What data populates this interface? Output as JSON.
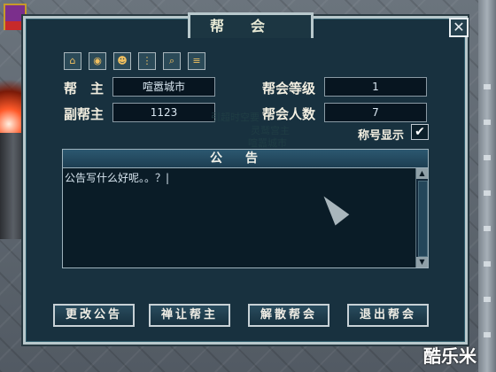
{
  "window": {
    "title": "帮会",
    "close_glyph": "✕"
  },
  "toolbar_icons": [
    "home-icon",
    "ring-icon",
    "members-icon",
    "tree-icon",
    "search-icon",
    "notes-icon"
  ],
  "fields": {
    "leader_label": "帮　主",
    "leader_value": "喧嚣城市",
    "vice_label": "副帮主",
    "vice_value": "1123",
    "level_label": "帮会等级",
    "level_value": "1",
    "members_label": "帮会人数",
    "members_value": "7",
    "title_display_label": "称号显示",
    "title_display_checked": "✔"
  },
  "background_text": {
    "line1": "引超时空要",
    "line2": "灵鹫宫主",
    "line3": "喧嚣城市"
  },
  "announcement": {
    "header": "公告",
    "text": "公告写什么好呢。。？|",
    "scroll_up": "▲",
    "scroll_down": "▼"
  },
  "buttons": {
    "edit": "更改公告",
    "transfer": "禅让帮主",
    "disband": "解散帮会",
    "quit": "退出帮会"
  },
  "watermark": "酷乐米"
}
